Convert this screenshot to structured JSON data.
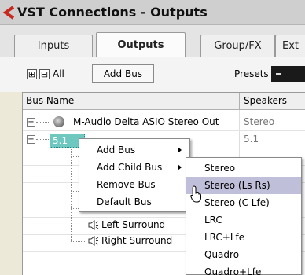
{
  "window": {
    "title": "VST Connections - Outputs",
    "icon": "cubase-logo-icon",
    "accent": "#c8281e"
  },
  "tabs": [
    {
      "label": "Inputs"
    },
    {
      "label": "Outputs",
      "active": true
    },
    {
      "label": "Group/FX"
    },
    {
      "label": "Ext"
    }
  ],
  "toolbar": {
    "all_label": "All",
    "expand_glyph": "⊞",
    "collapse_glyph": "⊟",
    "add_bus_label": "Add Bus",
    "presets_label": "Presets"
  },
  "table": {
    "columns": [
      "Bus Name",
      "Speakers"
    ],
    "rows": [
      {
        "name": "M-Audio Delta ASIO Stereo Out",
        "speakers": "Stereo",
        "expander": "+"
      },
      {
        "name": "5.1 Out",
        "speakers": "5.1",
        "expander": "−",
        "selected": true
      },
      {
        "name": "Left Surround",
        "icon": "speaker-icon"
      },
      {
        "name": "Right Surround",
        "icon": "speaker-icon"
      }
    ]
  },
  "context_menu": {
    "items": [
      {
        "label": "Add Bus",
        "submenu": true
      },
      {
        "label": "Add Child Bus",
        "submenu": true
      },
      {
        "label": "Remove Bus"
      },
      {
        "label": "Default Bus"
      }
    ]
  },
  "submenu": {
    "items": [
      {
        "label": "Stereo"
      },
      {
        "label": "Stereo (Ls Rs)",
        "highlighted": true
      },
      {
        "label": "Stereo (C Lfe)"
      },
      {
        "label": "LRC"
      },
      {
        "label": "LRC+Lfe"
      },
      {
        "label": "Quadro"
      },
      {
        "label": "Quadro+Lfe"
      }
    ]
  },
  "colors": {
    "selection": "#6fc8c0",
    "menu_highlight": "#bfbfd9"
  }
}
